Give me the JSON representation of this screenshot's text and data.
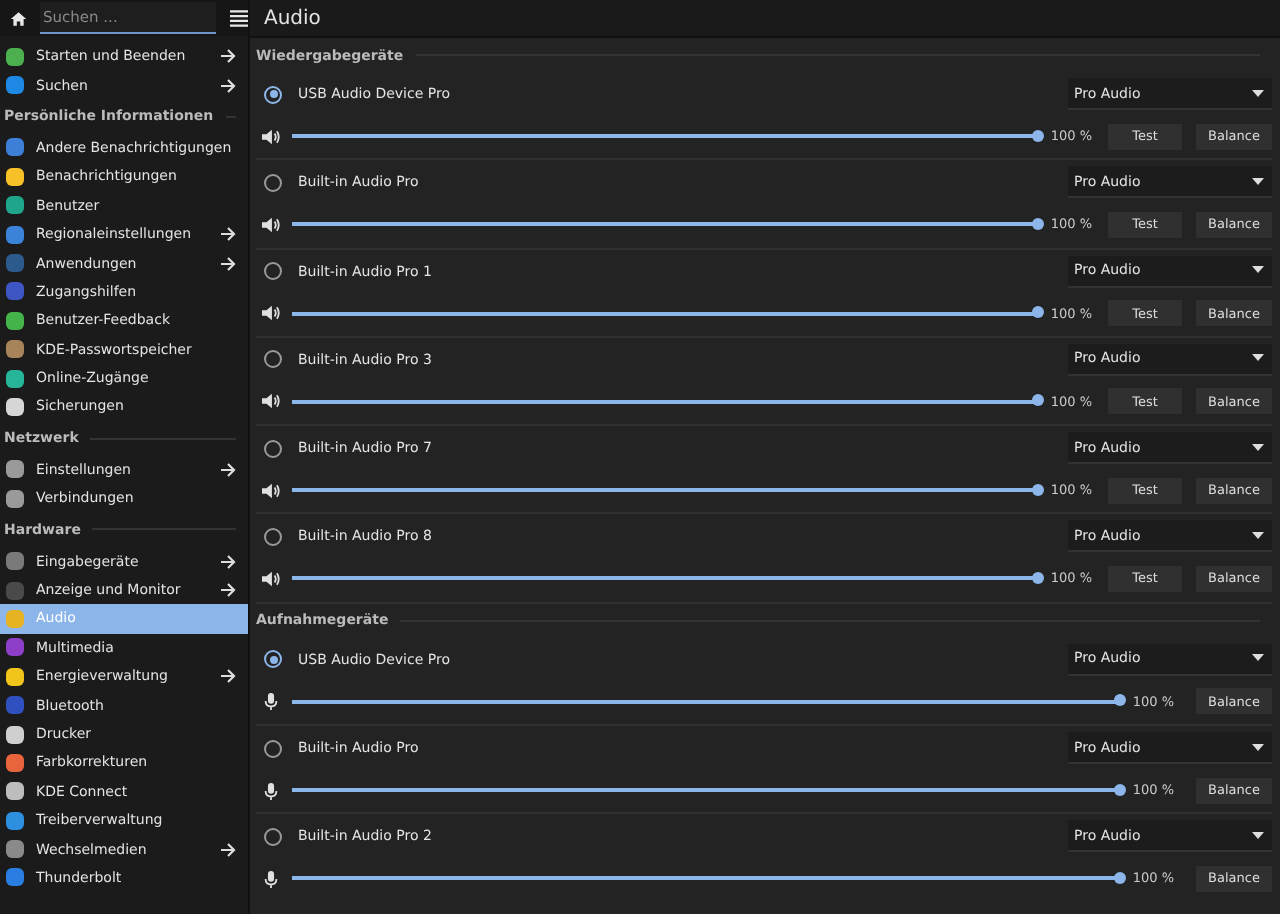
{
  "search": {
    "placeholder": "Suchen ..."
  },
  "sidebar": {
    "groups": [
      {
        "items": [
          {
            "label": "Starten und Beenden",
            "selected": false,
            "has_arrow": true,
            "color": "#4caf50"
          },
          {
            "label": "Suchen",
            "selected": false,
            "has_arrow": true,
            "color": "#1e88e5"
          }
        ]
      },
      {
        "title": "Persönliche Informationen",
        "items": [
          {
            "label": "Andere Benachrichtigungen",
            "selected": false,
            "has_arrow": false,
            "color": "#3d7fd6"
          },
          {
            "label": "Benachrichtigungen",
            "selected": false,
            "has_arrow": false,
            "color": "#f6c026"
          },
          {
            "label": "Benutzer",
            "selected": false,
            "has_arrow": false,
            "color": "#1fa58a"
          },
          {
            "label": "Regionaleinstellungen",
            "selected": false,
            "has_arrow": true,
            "color": "#3b82d9"
          },
          {
            "label": "Anwendungen",
            "selected": false,
            "has_arrow": true,
            "color": "#2c5a8c"
          },
          {
            "label": "Zugangshilfen",
            "selected": false,
            "has_arrow": false,
            "color": "#3d56c4"
          },
          {
            "label": "Benutzer-Feedback",
            "selected": false,
            "has_arrow": false,
            "color": "#43b34a"
          },
          {
            "label": "KDE-Passwortspeicher",
            "selected": false,
            "has_arrow": false,
            "color": "#a8845a"
          },
          {
            "label": "Online-Zugänge",
            "selected": false,
            "has_arrow": false,
            "color": "#27b59a"
          },
          {
            "label": "Sicherungen",
            "selected": false,
            "has_arrow": false,
            "color": "#d6d6d6"
          }
        ]
      },
      {
        "title": "Netzwerk",
        "items": [
          {
            "label": "Einstellungen",
            "selected": false,
            "has_arrow": true,
            "color": "#9a9a9a"
          },
          {
            "label": "Verbindungen",
            "selected": false,
            "has_arrow": false,
            "color": "#9a9a9a"
          }
        ]
      },
      {
        "title": "Hardware",
        "items": [
          {
            "label": "Eingabegeräte",
            "selected": false,
            "has_arrow": true,
            "color": "#7a7a7a"
          },
          {
            "label": "Anzeige und Monitor",
            "selected": false,
            "has_arrow": true,
            "color": "#4a4a4a"
          },
          {
            "label": "Audio",
            "selected": true,
            "has_arrow": false,
            "color": "#e6b422"
          },
          {
            "label": "Multimedia",
            "selected": false,
            "has_arrow": false,
            "color": "#8e3fc9"
          },
          {
            "label": "Energieverwaltung",
            "selected": false,
            "has_arrow": true,
            "color": "#f0c419"
          },
          {
            "label": "Bluetooth",
            "selected": false,
            "has_arrow": false,
            "color": "#3050c0"
          },
          {
            "label": "Drucker",
            "selected": false,
            "has_arrow": false,
            "color": "#cfcfcf"
          },
          {
            "label": "Farbkorrekturen",
            "selected": false,
            "has_arrow": false,
            "color": "#e8643c"
          },
          {
            "label": "KDE Connect",
            "selected": false,
            "has_arrow": false,
            "color": "#bdbdbd"
          },
          {
            "label": "Treiberverwaltung",
            "selected": false,
            "has_arrow": false,
            "color": "#2d8fe0"
          },
          {
            "label": "Wechselmedien",
            "selected": false,
            "has_arrow": true,
            "color": "#8a8a8a"
          },
          {
            "label": "Thunderbolt",
            "selected": false,
            "has_arrow": false,
            "color": "#2a7de1"
          }
        ]
      }
    ]
  },
  "page": {
    "title": "Audio"
  },
  "sections": [
    {
      "title": "Wiedergabegeräte",
      "kind": "playback",
      "devices": [
        {
          "name": "USB Audio Device Pro",
          "selected": true,
          "profile": "Pro Audio",
          "level": 1,
          "reading": "100 %",
          "buttons": [
            "Test",
            "Balance"
          ]
        },
        {
          "name": "Built-in Audio Pro",
          "selected": false,
          "profile": "Pro Audio",
          "level": 1,
          "reading": "100 %",
          "buttons": [
            "Test",
            "Balance"
          ]
        },
        {
          "name": "Built-in Audio Pro 1",
          "selected": false,
          "profile": "Pro Audio",
          "level": 1,
          "reading": "100 %",
          "buttons": [
            "Test",
            "Balance"
          ]
        },
        {
          "name": "Built-in Audio Pro 3",
          "selected": false,
          "profile": "Pro Audio",
          "level": 1,
          "reading": "100 %",
          "buttons": [
            "Test",
            "Balance"
          ]
        },
        {
          "name": "Built-in Audio Pro 7",
          "selected": false,
          "profile": "Pro Audio",
          "level": 1,
          "reading": "100 %",
          "buttons": [
            "Test",
            "Balance"
          ]
        },
        {
          "name": "Built-in Audio Pro 8",
          "selected": false,
          "profile": "Pro Audio",
          "level": 1,
          "reading": "100 %",
          "buttons": [
            "Test",
            "Balance"
          ]
        }
      ]
    },
    {
      "title": "Aufnahmegeräte",
      "kind": "capture",
      "devices": [
        {
          "name": "USB Audio Device Pro",
          "selected": true,
          "profile": "Pro Audio",
          "level": 1,
          "reading": "100 %",
          "buttons": [
            "Balance"
          ]
        },
        {
          "name": "Built-in Audio Pro",
          "selected": false,
          "profile": "Pro Audio",
          "level": 1,
          "reading": "100 %",
          "buttons": [
            "Balance"
          ]
        },
        {
          "name": "Built-in Audio Pro 2",
          "selected": false,
          "profile": "Pro Audio",
          "level": 1,
          "reading": "100 %",
          "buttons": [
            "Balance"
          ]
        }
      ]
    }
  ]
}
